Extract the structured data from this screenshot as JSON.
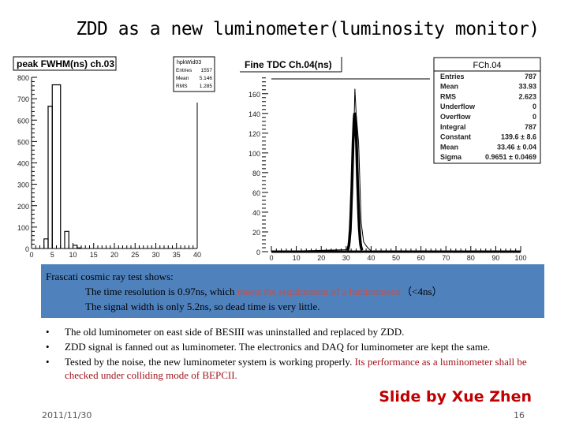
{
  "slide": {
    "title": "ZDD as a new luminometer(luminosity monitor)",
    "info_box": {
      "heading": "Frascati cosmic ray test shows:",
      "line1_prefix": "The time resolution is 0.97ns, which ",
      "line1_highlight": "meets the requirement of a luminometer",
      "line1_suffix": "（<4ns）",
      "line2": "The signal width is only 5.2ns, so dead time is very little."
    },
    "bullets": [
      {
        "marker": "•",
        "text": "The old luminometer on east side of BESIII was uninstalled and replaced by ZDD.",
        "highlight": ""
      },
      {
        "marker": "•",
        "text": "ZDD signal is fanned out as luminometer. The electronics and DAQ for luminometer are kept the same.",
        "highlight": ""
      },
      {
        "marker": "•",
        "text": "Tested by the noise, the new luminometer system is working properly. ",
        "highlight": "Its performance as a luminometer shall be checked under colliding mode of BEPCII."
      }
    ],
    "credit": "Slide by Xue Zhen",
    "date": "2011/11/30",
    "page_number": "16",
    "colors": {
      "info_box_bg": "#4f81bd",
      "highlight_red": "#c0504d",
      "credit_red": "#c00000"
    }
  },
  "chart_data": [
    {
      "type": "bar",
      "title": "peak FWHM(ns) ch.03",
      "xlabel": "",
      "ylabel": "",
      "xlim": [
        0,
        40
      ],
      "ylim": [
        0,
        800
      ],
      "xticks": [
        "0",
        "5",
        "10",
        "15",
        "20",
        "25",
        "30",
        "35",
        "40"
      ],
      "yticks": [
        "0",
        "100",
        "200",
        "300",
        "400",
        "500",
        "600",
        "700",
        "800"
      ],
      "bins": [
        {
          "x0": 3,
          "x1": 4,
          "value": 45
        },
        {
          "x0": 4,
          "x1": 5,
          "value": 665
        },
        {
          "x0": 5,
          "x1": 7,
          "value": 765
        },
        {
          "x0": 8,
          "x1": 9,
          "value": 80
        },
        {
          "x0": 10,
          "x1": 11,
          "value": 15
        },
        {
          "x0": 11,
          "x1": 12,
          "value": 3
        }
      ],
      "stats": {
        "name": "hpkWid03",
        "rows": [
          {
            "label": "Entries",
            "value": "1557"
          },
          {
            "label": "Mean",
            "value": "5.146"
          },
          {
            "label": "RMS",
            "value": "1.285"
          }
        ]
      }
    },
    {
      "type": "line",
      "title": "Fine TDC Ch.04(ns)",
      "xlabel": "",
      "ylabel": "",
      "xlim": [
        0,
        100
      ],
      "ylim": [
        0,
        175
      ],
      "xticks": [
        "0",
        "10",
        "20",
        "30",
        "40",
        "50",
        "60",
        "70",
        "80",
        "90",
        "100"
      ],
      "yticks": [
        "0",
        "20",
        "40",
        "60",
        "80",
        "100",
        "120",
        "140",
        "160"
      ],
      "histogram": {
        "x": [
          0,
          31,
          32,
          33,
          33.5,
          34,
          35,
          36,
          37,
          38,
          39,
          40,
          41,
          100
        ],
        "y": [
          0,
          2,
          20,
          110,
          165,
          140,
          110,
          30,
          10,
          6,
          3,
          1,
          0,
          0
        ]
      },
      "fit": {
        "type": "gaussian",
        "constant": 139.6,
        "mean": 33.46,
        "sigma": 0.9651
      },
      "stats": {
        "name": "FCh.04",
        "rows": [
          {
            "label": "Entries",
            "value": "787"
          },
          {
            "label": "Mean",
            "value": "33.93"
          },
          {
            "label": "RMS",
            "value": "2.623"
          },
          {
            "label": "Underflow",
            "value": "0"
          },
          {
            "label": "Overflow",
            "value": "0"
          },
          {
            "label": "Integral",
            "value": "787"
          },
          {
            "label": "Constant",
            "value": "139.6 ± 8.6"
          },
          {
            "label": "Mean",
            "value": "33.46 ± 0.04"
          },
          {
            "label": "Sigma",
            "value": "0.9651 ± 0.0469"
          }
        ]
      }
    }
  ]
}
